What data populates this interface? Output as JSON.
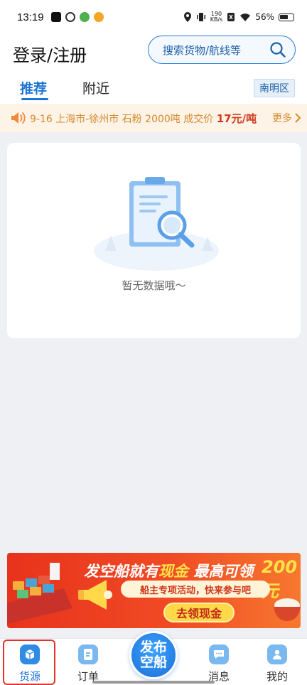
{
  "status_bar": {
    "time": "13:19",
    "speed_top": "190",
    "speed_bottom": "KB/s",
    "battery": "56%"
  },
  "header": {
    "title": "登录/注册",
    "search_placeholder": "搜索货物/航线等"
  },
  "tabs": {
    "items": [
      {
        "label": "推荐",
        "active": true
      },
      {
        "label": "附近",
        "active": false
      }
    ],
    "region": "南明区"
  },
  "ticker": {
    "text": "9-16 上海市-徐州市 石粉 2000吨  成交价",
    "price": "17元/吨",
    "more": "更多"
  },
  "empty_state": {
    "message": "暂无数据哦～"
  },
  "promo": {
    "line1_prefix": "发空船就有",
    "line1_highlight": "现金",
    "line1_suffix": " 最高可领",
    "amount": "200元",
    "line2": "船主专项活动，快来参与吧",
    "button": "去领现金"
  },
  "bottom_nav": {
    "items": [
      {
        "label": "货源",
        "active": true
      },
      {
        "label": "订单",
        "active": false
      },
      {
        "label": "消息",
        "active": false
      },
      {
        "label": "我的",
        "active": false
      }
    ],
    "publish_line1": "发布",
    "publish_line2": "空船"
  },
  "colors": {
    "accent": "#1e74d2",
    "ticker_text": "#d48a2c",
    "price": "#d33a1f",
    "promo_red": "#e8331c",
    "highlight_frame": "#e0352e"
  }
}
